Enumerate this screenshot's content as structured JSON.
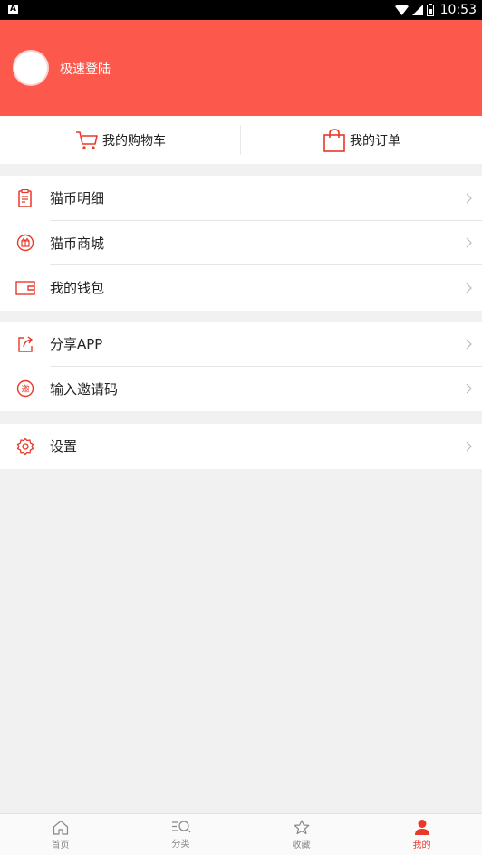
{
  "status_bar": {
    "time": "10:53"
  },
  "profile": {
    "login_label": "极速登陆"
  },
  "quick_links": [
    {
      "label": "我的购物车",
      "icon": "cart-icon"
    },
    {
      "label": "我的订单",
      "icon": "shopping-bag-icon"
    }
  ],
  "menu_group_1": [
    {
      "label": "猫币明细",
      "icon": "document-list-icon"
    },
    {
      "label": "猫币商城",
      "icon": "gift-icon"
    },
    {
      "label": "我的钱包",
      "icon": "wallet-icon"
    }
  ],
  "menu_group_2": [
    {
      "label": "分享APP",
      "icon": "share-icon"
    },
    {
      "label": "输入邀请码",
      "icon": "invite-icon"
    }
  ],
  "menu_group_3": [
    {
      "label": "设置",
      "icon": "settings-icon"
    }
  ],
  "tabbar": [
    {
      "label": "首页",
      "icon": "home-icon"
    },
    {
      "label": "分类",
      "icon": "category-search-icon"
    },
    {
      "label": "收藏",
      "icon": "star-icon"
    },
    {
      "label": "我的",
      "icon": "user-icon",
      "active": true
    }
  ],
  "colors": {
    "accent": "#fc594c",
    "icon_red": "#e8392a",
    "background": "#f1f1f1"
  }
}
